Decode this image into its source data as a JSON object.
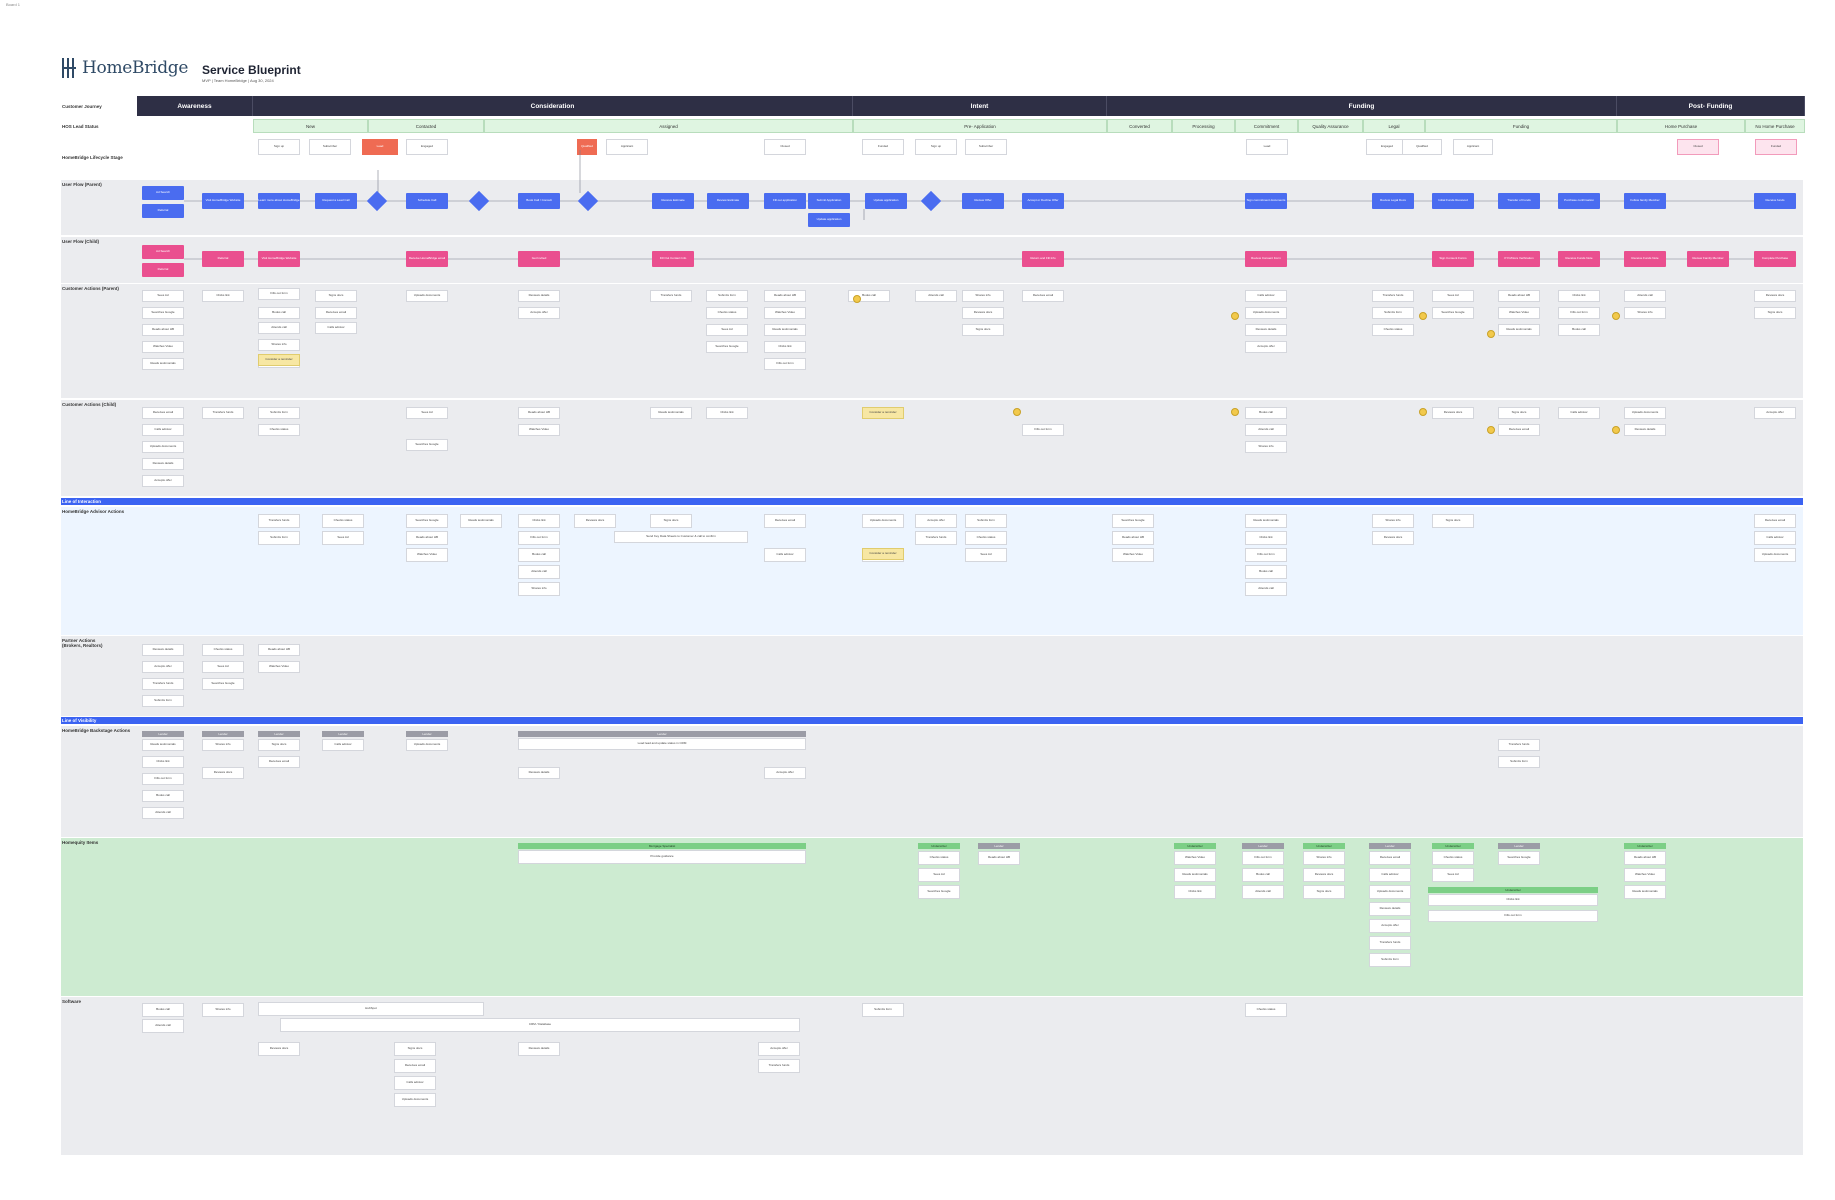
{
  "corner_tag": "Board 1",
  "brand": {
    "name": "HomeBridge"
  },
  "doc": {
    "title": "Service Blueprint",
    "meta": "MVP | Team HomeBridge | Aug 30, 2024"
  },
  "row_labels": {
    "journey": "Customer Journey",
    "lead_status": "HOS Lead Status",
    "lifecycle": "HomeBridge Lifecycle Stage",
    "flow_parent": "User Flow (Parent)",
    "flow_child": "User Flow (Child)",
    "actions_parent": "Customer Actions (Parent)",
    "actions_child": "Customer Actions (Child)",
    "line_interaction": "Line of Interaction",
    "advisor": "HomeBridge Advisor Actions",
    "partner": "Partner Actions (Brokers, Realtors)",
    "line_visibility": "Line of Visibility",
    "backstage": "HomeBridge Backstage Actions",
    "third_party": "Homequity Items",
    "software": "Software"
  },
  "stages": [
    "Awareness",
    "Consideration",
    "Intent",
    "Funding",
    "Post- Funding"
  ],
  "lead_statuses": [
    "New",
    "Contacted",
    "Assigned",
    "Pre- Application",
    "Converted",
    "Processing",
    "Commitment",
    "Quality Assurance",
    "Legal",
    "Funding",
    "Home Purchase",
    "No Home Purchase"
  ],
  "lifecycle_cards": [
    "Sign up",
    "Subscriber",
    "Lead",
    "Engaged",
    "Qualified",
    "Applicant",
    "Closed",
    "Funded"
  ],
  "flow_labels": {
    "entry_1": "Ad Search",
    "entry_2": "Referral",
    "decision": "Eligible?",
    "n_parent": [
      "Visit HomeBridge Website",
      "Learn more about HomeBridge",
      "Request a Lead Call",
      "Schedule Call",
      "Book Call / Consult",
      "Receive Estimate",
      "Review Estimate",
      "Fill out application",
      "Submit Application",
      "Update application",
      "Review Offer",
      "Accept or Decline Offer",
      "Sign commitment documents",
      "Review Legal Docs",
      "Initial Funds Received",
      "Transfer of Funds",
      "Purchase confirmation",
      "Follow family Member",
      "Receive funds",
      "Purchase support"
    ],
    "n_child": [
      "Referral",
      "Visit HomeBridge Website",
      "Receive HomeBridge email",
      "Get Invited",
      "Fill Out Contact Info",
      "Return and Fill Info",
      "Review Consent Form",
      "Sign Consent Forms",
      "KYC/Docs Verification",
      "Receive Funds Note",
      "Receive Funds Note",
      "Review Family Member",
      "Complete Purchase"
    ]
  },
  "sections": {
    "card_texts": [
      "Sees Ad",
      "Searches Google",
      "Reads about HB",
      "Watches Video",
      "Reads testimonials",
      "Clicks link",
      "Fills out form",
      "Books call",
      "Attends call",
      "Shares info",
      "Reviews docs",
      "Signs docs",
      "Receives email",
      "Calls advisor",
      "Uploads documents",
      "Reviews details",
      "Accepts offer",
      "Transfers funds",
      "Submits form",
      "Checks status"
    ],
    "yellow_note": "Consider a reminder",
    "advisor_wide": "Send Key Data Sheets to Customer & call to confirm",
    "backstage_wide": "Load lead and update status in CRM",
    "third_party_header": "Mortgage Specialist",
    "third_party_body": "Provide guidance",
    "hdr_gray": "Lender",
    "hdr_green": "Underwriter",
    "software_wide_1": "HubSpot",
    "software_wide_2": "CRM / Database"
  },
  "colors": {
    "stage_bg": "#2e2f45",
    "lead_bg": "#dff5e1",
    "flow_blue": "#4a6cf0",
    "flow_pink": "#ea4f8f",
    "line_blue": "#3b63f2",
    "band_gray": "#ebecef",
    "band_light_blue": "#edf5ff",
    "band_green": "#cdebd1"
  }
}
